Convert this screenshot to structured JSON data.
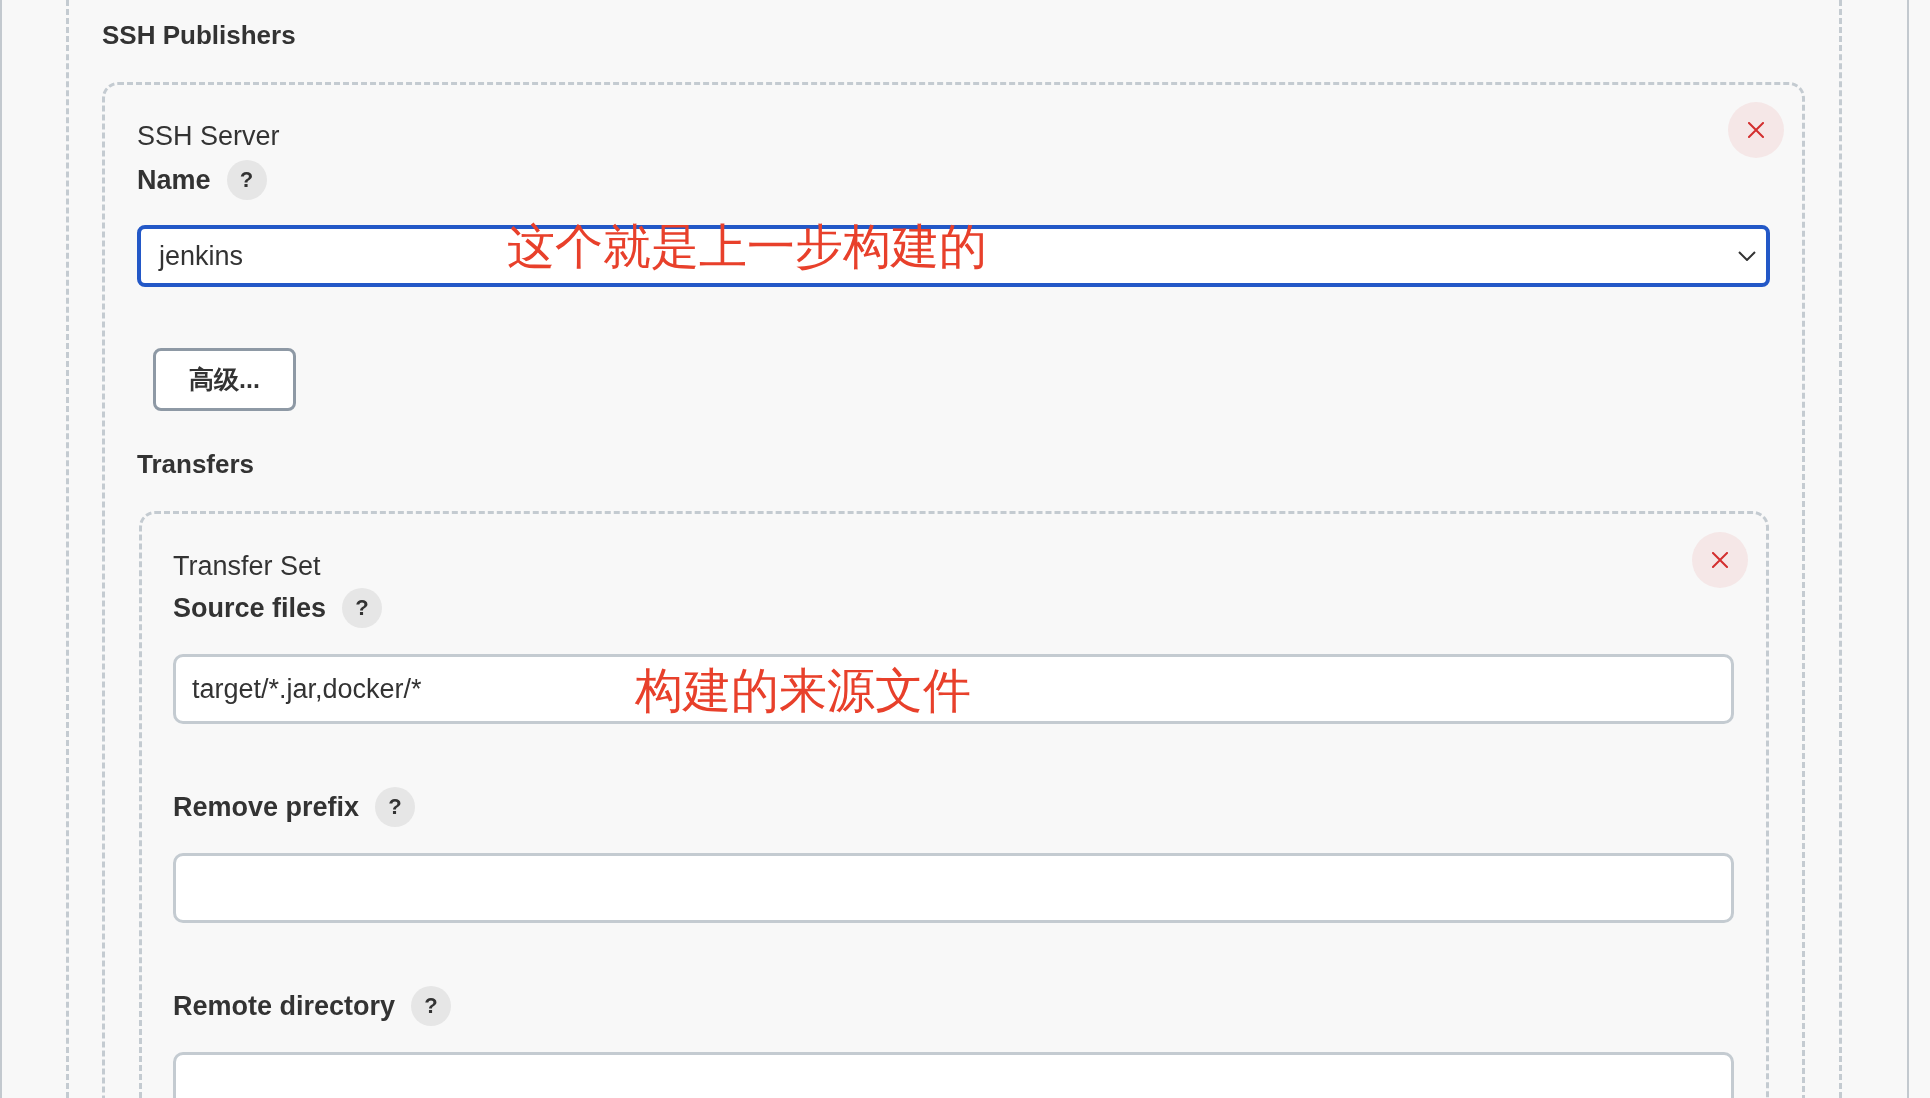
{
  "section": {
    "title": "SSH Publishers"
  },
  "server": {
    "heading": "SSH Server",
    "name_field": {
      "label": "Name",
      "help": "?",
      "value": "jenkins",
      "focused": true,
      "annotation": "这个就是上一步构建的"
    },
    "advanced_button": "高级...",
    "transfers": {
      "title": "Transfers",
      "transfer_set": {
        "heading": "Transfer Set",
        "fields": [
          {
            "label": "Source files",
            "help": "?",
            "value": "target/*.jar,docker/*",
            "annotation": "构建的来源文件"
          },
          {
            "label": "Remove prefix",
            "help": "?"
          },
          {
            "label": "Remote directory",
            "help": "?"
          }
        ]
      }
    }
  }
}
